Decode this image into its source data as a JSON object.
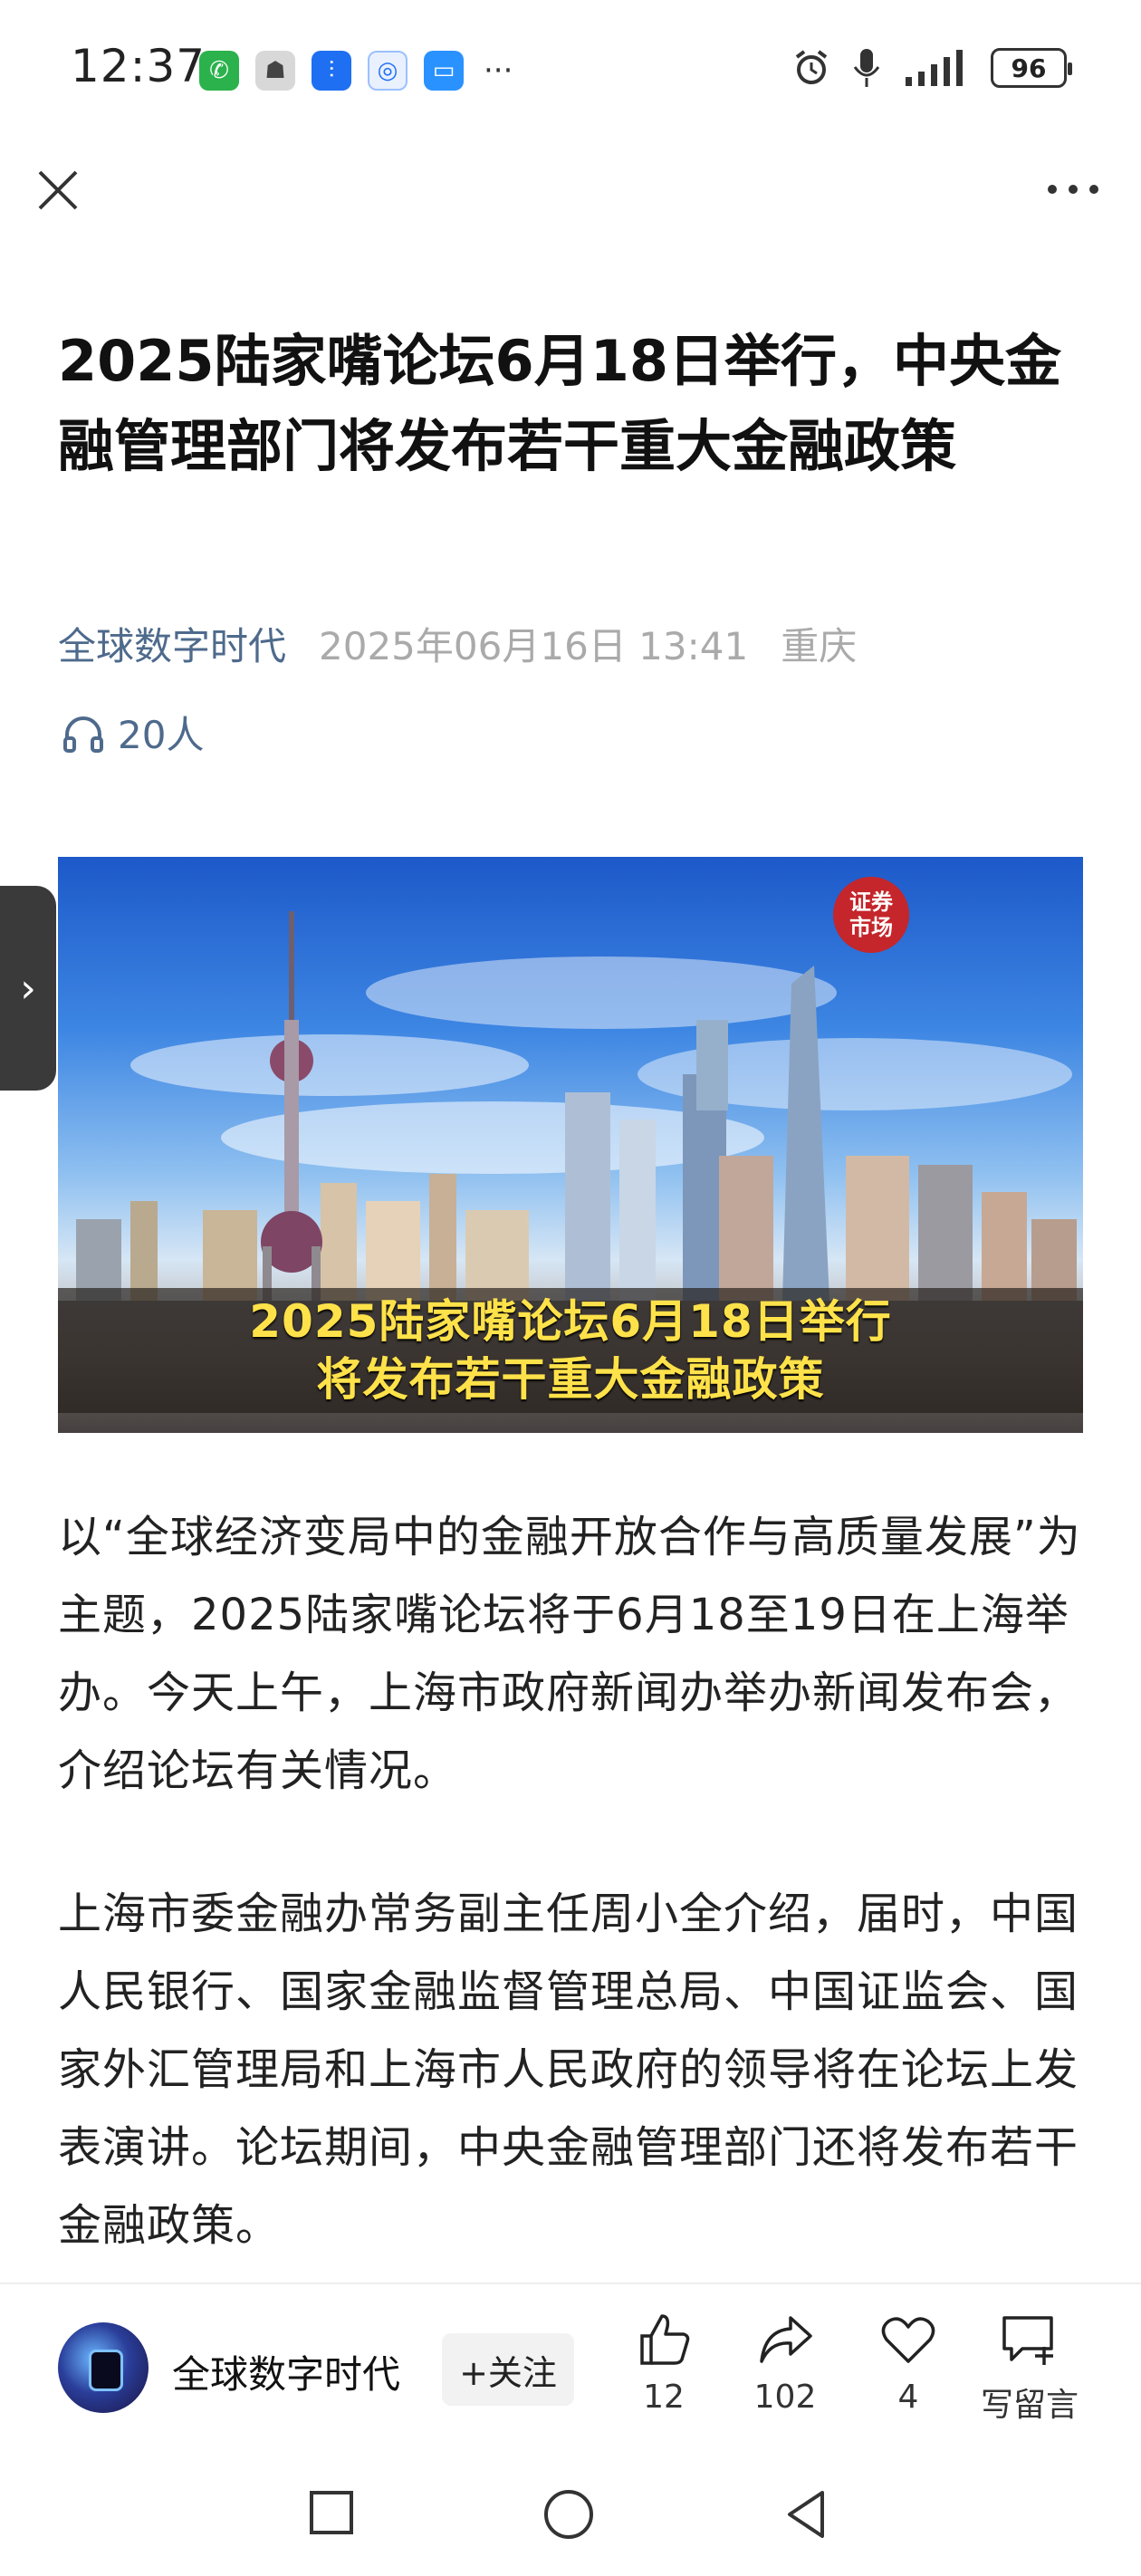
{
  "status_bar": {
    "time": "12:37",
    "battery": "96",
    "more_indicator": "···",
    "notification_icons": [
      "phone-icon",
      "contact-icon",
      "voice-icon",
      "browser-icon",
      "chat-icon"
    ],
    "system_icons": [
      "alarm-icon",
      "mic-icon",
      "signal-icon",
      "battery-icon"
    ]
  },
  "nav": {
    "close_label": "✕",
    "more_label": "···"
  },
  "article": {
    "title": "2025陆家嘴论坛6月18日举行，中央金融管理部门将发布若干重大金融政策",
    "author": "全球数字时代",
    "date": "2025年06月16日 13:41",
    "location": "重庆",
    "listeners": "20人",
    "image_caption_line1": "2025陆家嘴论坛6月18日举行",
    "image_caption_line2": "将发布若干重大金融政策",
    "image_logo_line1": "证券",
    "image_logo_line2": "市场",
    "paragraph1": "以“全球经济变局中的金融开放合作与高质量发展”为主题，2025陆家嘴论坛将于6月18至19日在上海举办。今天上午，上海市政府新闻办举办新闻发布会，介绍论坛有关情况。",
    "paragraph2": "上海市委金融办常务副主任周小全介绍，届时，中国人民银行、国家金融监督管理总局、中国证监会、国家外汇管理局和上海市人民政府的领导将在论坛上发表演讲。论坛期间，中央金融管理部门还将发布若干金融政策。"
  },
  "side_tab": {
    "label": "›"
  },
  "bottom_bar": {
    "author": "全球数字时代",
    "follow_label": "+关注",
    "like_count": "12",
    "share_count": "102",
    "favorite_count": "4",
    "comment_label": "写留言"
  },
  "colors": {
    "author_link": "#4e6a8c",
    "caption_text": "#ffe24a",
    "logo_red": "#c4262b"
  }
}
